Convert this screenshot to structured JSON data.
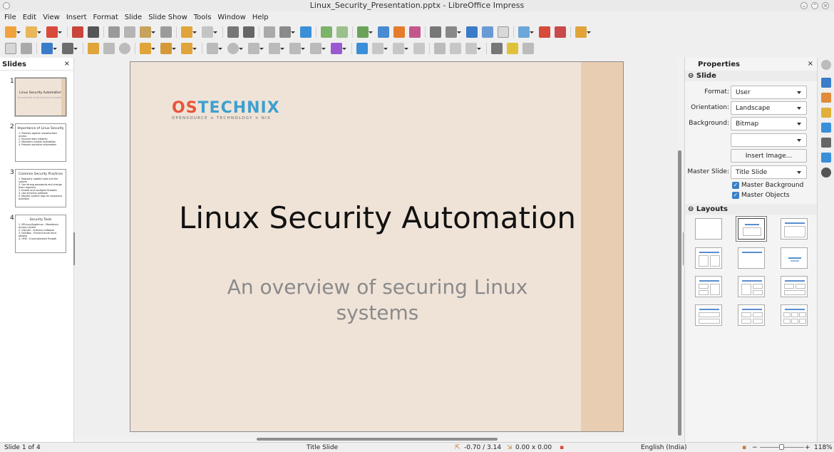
{
  "window": {
    "title": "Linux_Security_Presentation.pptx - LibreOffice Impress"
  },
  "menu": [
    "File",
    "Edit",
    "View",
    "Insert",
    "Format",
    "Slide",
    "Slide Show",
    "Tools",
    "Window",
    "Help"
  ],
  "slides_panel": {
    "title": "Slides",
    "slides": [
      {
        "num": "1",
        "title": "Linux Security Automation",
        "subtitle": "An overview of securing Linux systems",
        "bullets": []
      },
      {
        "num": "2",
        "title": "Importance of Linux Security",
        "bullets": [
          "1. Protects against unauthorized access",
          "2. Ensures data integrity",
          "3. Maintains system availability",
          "4. Protects sensitive information"
        ]
      },
      {
        "num": "3",
        "title": "Common Security Practices",
        "bullets": [
          "1. Regularly update tools and the system",
          "2. Use strong passwords and change them regularly",
          "3. Enable and configure firewalls",
          "4. Use antivirus software",
          "5. Monitor system logs for suspicious activities"
        ]
      },
      {
        "num": "4",
        "title": "Security Tools",
        "bullets": [
          "1. SELinux/AppArmor - Mandatory Access Control",
          "2. ClamAV - Antivirus software",
          "3. Fail2Ban - Prevent brute force attacks",
          "4. UFW - Uncomplicated Firewall"
        ]
      }
    ]
  },
  "slide": {
    "logo_text_a": "OS",
    "logo_text_b": "TECHNIX",
    "logo_tagline": "OPENSOURCE × TECHNOLOGY × NIX",
    "title": "Linux Security Automation",
    "subtitle": "An overview of securing Linux systems"
  },
  "properties": {
    "title": "Properties",
    "slide_section": "Slide",
    "format_label": "Format:",
    "format_value": "User",
    "orientation_label": "Orientation:",
    "orientation_value": "Landscape",
    "background_label": "Background:",
    "background_value": "Bitmap",
    "background_sub_value": "",
    "insert_image_label": "Insert Image...",
    "master_slide_label": "Master Slide:",
    "master_slide_value": "Title Slide",
    "master_background_label": "Master Background",
    "master_objects_label": "Master Objects",
    "layouts_section": "Layouts"
  },
  "statusbar": {
    "slide_position": "Slide 1 of 4",
    "layout_name": "Title Slide",
    "cursor_position": "-0.70 / 3.14",
    "object_size": "0.00 x 0.00",
    "language": "English (India)",
    "zoom": "118%"
  },
  "colors": {
    "slide_background": "#efe3d8",
    "slide_band": "#e8cdb3",
    "logo_orange": "#e8553a",
    "logo_blue": "#3ea0cf",
    "accent": "#3b80c8"
  }
}
